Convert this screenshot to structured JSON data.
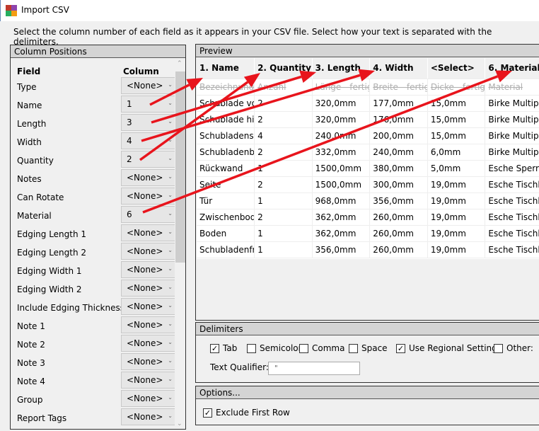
{
  "window": {
    "title": "Import CSV",
    "icon": "app-grid-icon"
  },
  "intro": "Select the column number of each field as it appears in your CSV file. Select how your text is separated with the delimiters.",
  "column_positions": {
    "title": "Column Positions",
    "field_header": "Field",
    "column_header": "Column",
    "rows": [
      {
        "field": "Type",
        "column": "<None>"
      },
      {
        "field": "Name",
        "column": "1"
      },
      {
        "field": "Length",
        "column": "3"
      },
      {
        "field": "Width",
        "column": "4"
      },
      {
        "field": "Quantity",
        "column": "2"
      },
      {
        "field": "Notes",
        "column": "<None>"
      },
      {
        "field": "Can Rotate",
        "column": "<None>"
      },
      {
        "field": "Material",
        "column": "6"
      },
      {
        "field": "Edging Length 1",
        "column": "<None>"
      },
      {
        "field": "Edging Length 2",
        "column": "<None>"
      },
      {
        "field": "Edging Width 1",
        "column": "<None>"
      },
      {
        "field": "Edging Width 2",
        "column": "<None>"
      },
      {
        "field": "Include Edging Thickness",
        "column": "<None>"
      },
      {
        "field": "Note 1",
        "column": "<None>"
      },
      {
        "field": "Note 2",
        "column": "<None>"
      },
      {
        "field": "Note 3",
        "column": "<None>"
      },
      {
        "field": "Note 4",
        "column": "<None>"
      },
      {
        "field": "Group",
        "column": "<None>"
      },
      {
        "field": "Report Tags",
        "column": "<None>"
      }
    ]
  },
  "preview": {
    "title": "Preview",
    "headers": [
      "1. Name",
      "2. Quantity",
      "3. Length",
      "4. Width",
      "<Select>",
      "6. Material"
    ],
    "excluded_row": [
      "Bezeichnung",
      "Anzahl",
      "Länge - fertig",
      "Breite - fertig",
      "Dicke - fertig",
      "Material"
    ],
    "rows": [
      [
        "Schublade vor",
        "2",
        "320,0mm",
        "177,0mm",
        "15,0mm",
        "Birke Multiplex"
      ],
      [
        "Schublade hin",
        "2",
        "320,0mm",
        "176,0mm",
        "15,0mm",
        "Birke Multiplex"
      ],
      [
        "Schubladensei",
        "4",
        "240,0mm",
        "200,0mm",
        "15,0mm",
        "Birke Multiplex"
      ],
      [
        "Schubladenbo",
        "2",
        "332,0mm",
        "240,0mm",
        "6,0mm",
        "Birke Multiplex"
      ],
      [
        "Rückwand",
        "1",
        "1500,0mm",
        "380,0mm",
        "5,0mm",
        "Esche Sperrholz"
      ],
      [
        "Seite",
        "2",
        "1500,0mm",
        "300,0mm",
        "19,0mm",
        "Esche Tischlerplatte"
      ],
      [
        "Tür",
        "1",
        "968,0mm",
        "356,0mm",
        "19,0mm",
        "Esche Tischlerplatte"
      ],
      [
        "Zwischenbode",
        "2",
        "362,0mm",
        "260,0mm",
        "19,0mm",
        "Esche Tischlerplatte"
      ],
      [
        "Boden",
        "1",
        "362,0mm",
        "260,0mm",
        "19,0mm",
        "Esche Tischlerplatte"
      ],
      [
        "Schubladenfrc",
        "1",
        "356,0mm",
        "260,0mm",
        "19,0mm",
        "Esche Tischlerplatte"
      ]
    ]
  },
  "delimiters": {
    "title": "Delimiters",
    "options": [
      {
        "label": "Tab",
        "checked": true
      },
      {
        "label": "Semicolon",
        "checked": false
      },
      {
        "label": "Comma",
        "checked": false
      },
      {
        "label": "Space",
        "checked": false
      },
      {
        "label": "Use Regional Setting",
        "checked": true
      },
      {
        "label": "Other:",
        "checked": false
      }
    ],
    "text_qualifier_label": "Text Qualifier:",
    "text_qualifier_value": "\""
  },
  "options": {
    "title": "Options...",
    "exclude_first_row": {
      "label": "Exclude First Row",
      "checked": true
    }
  },
  "annotation_color": "#e8141c"
}
